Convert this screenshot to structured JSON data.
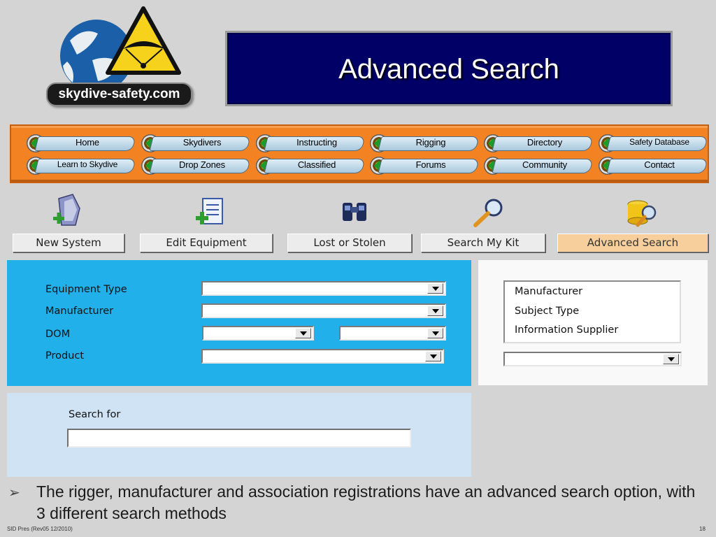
{
  "logo": {
    "text": "skydive-safety.com"
  },
  "title": "Advanced Search",
  "nav": {
    "items": [
      "Home",
      "Skydivers",
      "Instructing",
      "Rigging",
      "Directory",
      "Safety Database",
      "Learn to Skydive",
      "Drop Zones",
      "Classified",
      "Forums",
      "Community",
      "Contact"
    ]
  },
  "toolbar": {
    "buttons": [
      {
        "label": "New System",
        "icon": "device-add-icon",
        "active": false
      },
      {
        "label": "Edit  Equipment",
        "icon": "document-edit-icon",
        "active": false
      },
      {
        "label": "Lost or Stolen",
        "icon": "binoculars-icon",
        "active": false
      },
      {
        "label": "Search My Kit",
        "icon": "magnifier-icon",
        "active": false
      },
      {
        "label": "Advanced Search",
        "icon": "database-search-icon",
        "active": true
      }
    ],
    "active_color": "#f7cf9c"
  },
  "filters": {
    "labels": [
      "Equipment Type",
      "Manufacturer",
      "DOM",
      "Product"
    ],
    "panel_color": "#21b0ea"
  },
  "methods": {
    "options": [
      "Manufacturer",
      "Subject Type",
      "Information Supplier"
    ]
  },
  "search": {
    "label": "Search for",
    "value": ""
  },
  "bullet": "The rigger, manufacturer and association registrations have an advanced search option, with 3 different search methods",
  "footer": {
    "left": "SID Pres (Rev05 12/2010)",
    "right": "18"
  },
  "colors": {
    "banner": "#000066",
    "nav": "#f28222",
    "search_panel": "#cfe3f5"
  }
}
